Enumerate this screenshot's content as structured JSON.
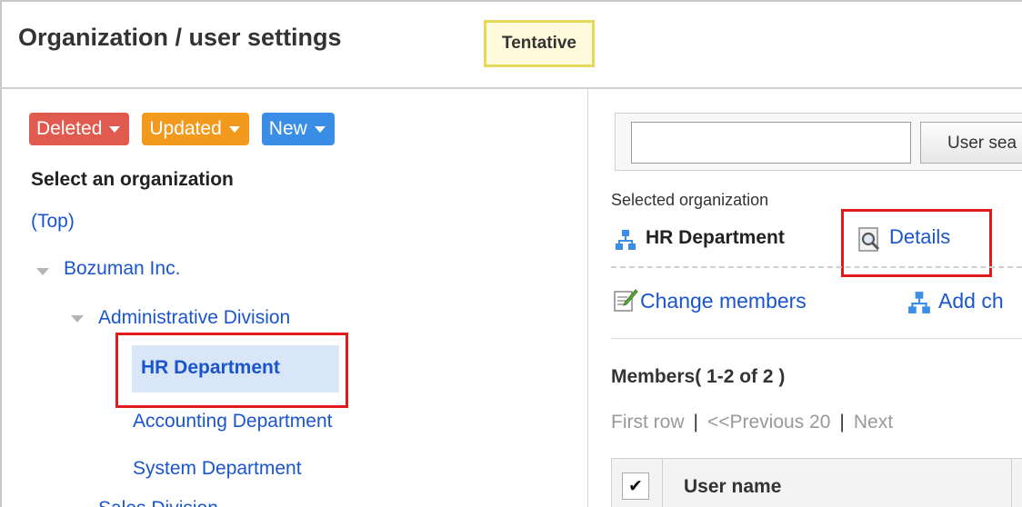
{
  "header": {
    "title": "Organization / user settings",
    "badge": "Tentative"
  },
  "filters": {
    "deleted": "Deleted",
    "updated": "Updated",
    "new": "New"
  },
  "tree": {
    "heading": "Select an organization",
    "top_link": "(Top)",
    "root": "Bozuman Inc.",
    "division": "Administrative Division",
    "selected": "HR Department",
    "children": [
      "Accounting Department",
      "System Department"
    ],
    "cut_off_item": "Sales Division"
  },
  "search": {
    "value": "",
    "button": "User sea"
  },
  "selected_org": {
    "label": "Selected organization",
    "name": "HR Department",
    "details": "Details"
  },
  "actions": {
    "change_members": "Change members",
    "add_child": "Add ch"
  },
  "members": {
    "summary": "Members( 1-2 of 2 )",
    "pager_first": "First row",
    "pager_prev": "<<Previous 20",
    "pager_next": "Next"
  },
  "table": {
    "check_mark": "✔",
    "col_user_name": "User name"
  },
  "colors": {
    "link": "#1a55cc",
    "deleted": "#e05a4f",
    "updated": "#f29a1e",
    "new": "#3a8ee6",
    "highlight": "#e11b1b"
  }
}
